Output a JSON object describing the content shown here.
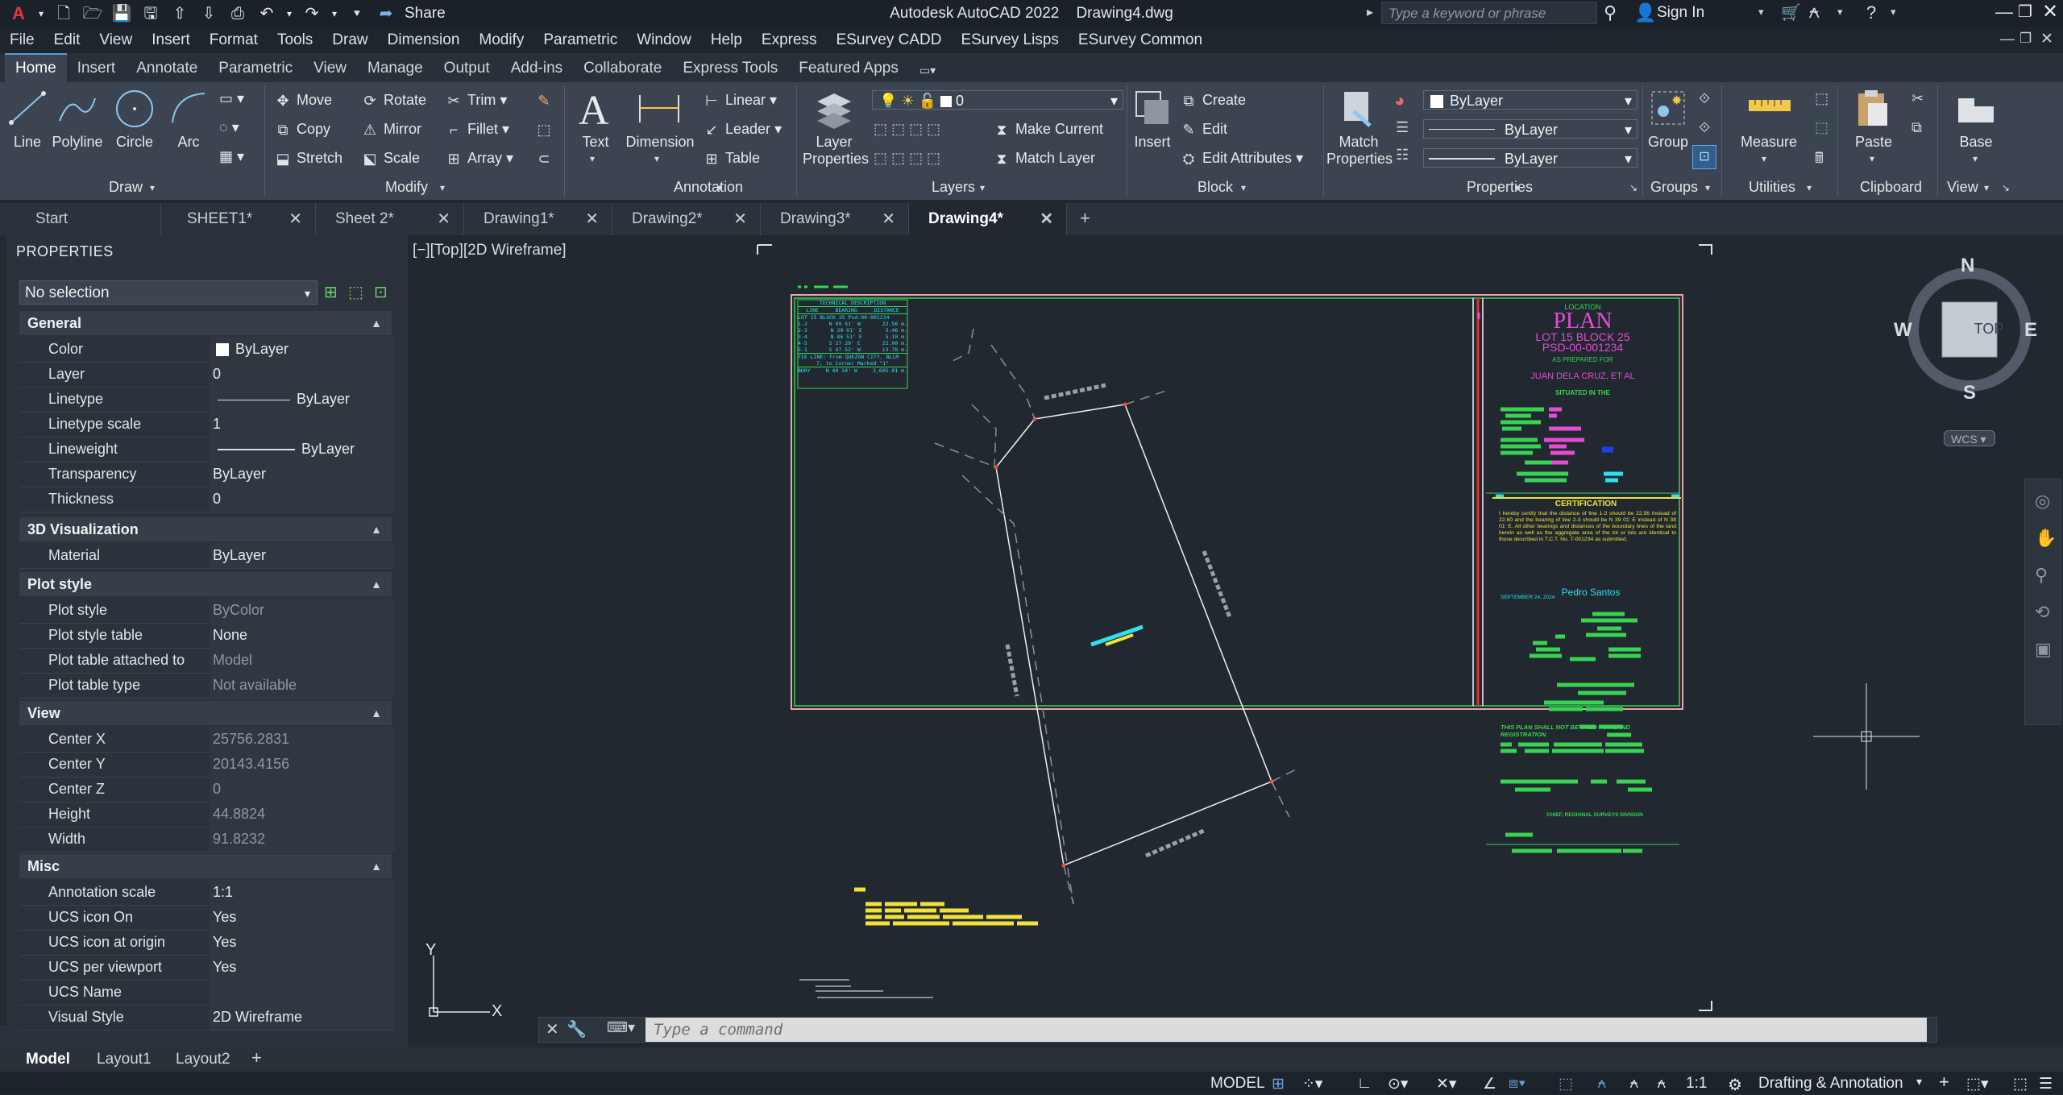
{
  "app": {
    "title": "Autodesk AutoCAD 2022",
    "document": "Drawing4.dwg",
    "share_label": "Share",
    "search_placeholder": "Type a keyword or phrase",
    "sign_in": "Sign In"
  },
  "menu": [
    "File",
    "Edit",
    "View",
    "Insert",
    "Format",
    "Tools",
    "Draw",
    "Dimension",
    "Modify",
    "Parametric",
    "Window",
    "Help",
    "Express",
    "ESurvey CADD",
    "ESurvey Lisps",
    "ESurvey Common"
  ],
  "ribbon_tabs": [
    "Home",
    "Insert",
    "Annotate",
    "Parametric",
    "View",
    "Manage",
    "Output",
    "Add-ins",
    "Collaborate",
    "Express Tools",
    "Featured Apps"
  ],
  "active_ribbon_tab": "Home",
  "ribbon": {
    "draw": {
      "title": "Draw",
      "line": "Line",
      "polyline": "Polyline",
      "circle": "Circle",
      "arc": "Arc"
    },
    "modify": {
      "title": "Modify",
      "move": "Move",
      "rotate": "Rotate",
      "trim": "Trim",
      "copy": "Copy",
      "mirror": "Mirror",
      "fillet": "Fillet",
      "stretch": "Stretch",
      "scale": "Scale",
      "array": "Array"
    },
    "annotation": {
      "title": "Annotation",
      "text": "Text",
      "dimension": "Dimension",
      "linear": "Linear",
      "leader": "Leader",
      "table": "Table"
    },
    "layers": {
      "title": "Layers",
      "layer_properties_1": "Layer",
      "layer_properties_2": "Properties",
      "current_layer": "0",
      "make_current": "Make Current",
      "match_layer": "Match Layer"
    },
    "block": {
      "title": "Block",
      "insert": "Insert",
      "create": "Create",
      "edit": "Edit",
      "edit_attributes": "Edit Attributes"
    },
    "properties": {
      "title": "Properties",
      "match_1": "Match",
      "match_2": "Properties",
      "color": "ByLayer",
      "linetype": "ByLayer",
      "lineweight": "ByLayer"
    },
    "groups": {
      "title": "Groups",
      "group": "Group"
    },
    "utilities": {
      "title": "Utilities",
      "measure": "Measure"
    },
    "clipboard": {
      "title": "Clipboard",
      "paste": "Paste"
    },
    "view": {
      "title": "View",
      "base": "Base"
    }
  },
  "doc_tabs": [
    "Start",
    "SHEET1*",
    "Sheet 2*",
    "Drawing1*",
    "Drawing2*",
    "Drawing3*",
    "Drawing4*"
  ],
  "properties_panel": {
    "title": "PROPERTIES",
    "selection": "No selection",
    "sections": {
      "general": {
        "title": "General",
        "rows": [
          {
            "name": "Color",
            "value": "ByLayer"
          },
          {
            "name": "Layer",
            "value": "0"
          },
          {
            "name": "Linetype",
            "value": "ByLayer"
          },
          {
            "name": "Linetype scale",
            "value": "1"
          },
          {
            "name": "Lineweight",
            "value": "ByLayer"
          },
          {
            "name": "Transparency",
            "value": "ByLayer"
          },
          {
            "name": "Thickness",
            "value": "0"
          }
        ]
      },
      "viz": {
        "title": "3D Visualization",
        "rows": [
          {
            "name": "Material",
            "value": "ByLayer"
          }
        ]
      },
      "plot": {
        "title": "Plot style",
        "rows": [
          {
            "name": "Plot style",
            "value": "ByColor"
          },
          {
            "name": "Plot style table",
            "value": "None"
          },
          {
            "name": "Plot table attached to",
            "value": "Model"
          },
          {
            "name": "Plot table type",
            "value": "Not available"
          }
        ]
      },
      "view": {
        "title": "View",
        "rows": [
          {
            "name": "Center X",
            "value": "25756.2831"
          },
          {
            "name": "Center Y",
            "value": "20143.4156"
          },
          {
            "name": "Center Z",
            "value": "0"
          },
          {
            "name": "Height",
            "value": "44.8824"
          },
          {
            "name": "Width",
            "value": "91.8232"
          }
        ]
      },
      "misc": {
        "title": "Misc",
        "rows": [
          {
            "name": "Annotation scale",
            "value": "1:1"
          },
          {
            "name": "UCS icon On",
            "value": "Yes"
          },
          {
            "name": "UCS icon at origin",
            "value": "Yes"
          },
          {
            "name": "UCS per viewport",
            "value": "Yes"
          },
          {
            "name": "UCS Name",
            "value": ""
          },
          {
            "name": "Visual Style",
            "value": "2D Wireframe"
          }
        ]
      }
    }
  },
  "viewport": {
    "label": "[−][Top][2D Wireframe]",
    "compass": {
      "n": "N",
      "s": "S",
      "e": "E",
      "w": "W",
      "top": "TOP",
      "wcs": "WCS"
    },
    "ucs": {
      "x": "X",
      "y": "Y"
    }
  },
  "drawing": {
    "tech_title": "TECHNICAL DESCRIPTION",
    "tech_headers": [
      "LINE",
      "BEARING",
      "DISTANCE"
    ],
    "tech_subtitle": "LOT 15 BLOCK 25 Psd-00-001234",
    "tech_rows": [
      [
        "1-2",
        "N 09 51' W",
        "22.56 m."
      ],
      [
        "2-3",
        "N 39 01' E",
        "3.46 m."
      ],
      [
        "3-4",
        "N 86 51' E",
        "5.10 m."
      ],
      [
        "4-5",
        "S 27 29' E",
        "22.00 m."
      ],
      [
        "5-1",
        "S 47 52' W",
        "13.78 m."
      ]
    ],
    "tie_line": "TIE LINE: From QUEZON CITY, BLLM",
    "tie_line2": "7, to Corner Marked \"1\"",
    "tie_row": [
      "BDRY",
      "N 40 34' W",
      "3,605.01 m."
    ],
    "location": "LOCATION",
    "plan": "PLAN",
    "lot": "LOT 15 BLOCK 25",
    "psd": "PSD-00-001234",
    "prepared": "AS PREPARED FOR",
    "owner": "JUAN DELA CRUZ, ET AL",
    "situated": "SITUATED IN THE",
    "cert_title": "CERTIFICATION",
    "cert_text": "I hereby certify that the distance of line 1-2 should be 22.56 instead of 22.60 and the bearing of line 2-3 should be N 39 01' E instead of N 38 01' E. All other bearings and distances of the boundary lines of the land herein as well as the aggregate area of the lot or lots are identical to those described in T.C.T. No. T-001234 as submitted.",
    "surveyor": "Pedro Santos",
    "date": "SEPTEMBER 24, 2024",
    "notice": "THIS PLAN SHALL NOT BE USED FOR LAND REGISTRATION.",
    "chief": "CHIEF, REGIONAL SURVEYS DIVISION"
  },
  "command": {
    "placeholder": "Type a command"
  },
  "layout_tabs": [
    "Model",
    "Layout1",
    "Layout2"
  ],
  "status": {
    "model": "MODEL",
    "scale": "1:1",
    "workspace": "Drafting & Annotation"
  }
}
